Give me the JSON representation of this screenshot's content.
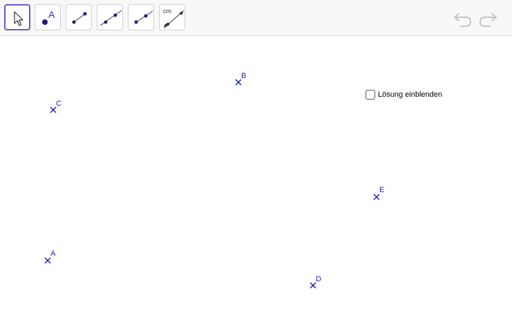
{
  "toolbar": {
    "tools": [
      {
        "name": "move-tool",
        "icon": "cursor-arrow-icon",
        "selected": true
      },
      {
        "name": "point-tool",
        "icon": "point-icon",
        "label": "A"
      },
      {
        "name": "segment-tool",
        "icon": "segment-icon"
      },
      {
        "name": "line-tool",
        "icon": "line-icon"
      },
      {
        "name": "ray-tool",
        "icon": "ray-icon"
      },
      {
        "name": "segment-length-tool",
        "icon": "segment-with-length-icon",
        "label": "cm"
      }
    ],
    "undo_icon": "undo-icon",
    "redo_icon": "redo-icon"
  },
  "points": {
    "A": "A",
    "B": "B",
    "C": "C",
    "D": "D",
    "E": "E"
  },
  "checkbox": {
    "label": "Lösung einblenden",
    "checked": false
  },
  "colors": {
    "point": "#1e1eb4",
    "selected_tool_border": "#6557d2",
    "toolbar_bg": "#f8f8f8"
  }
}
